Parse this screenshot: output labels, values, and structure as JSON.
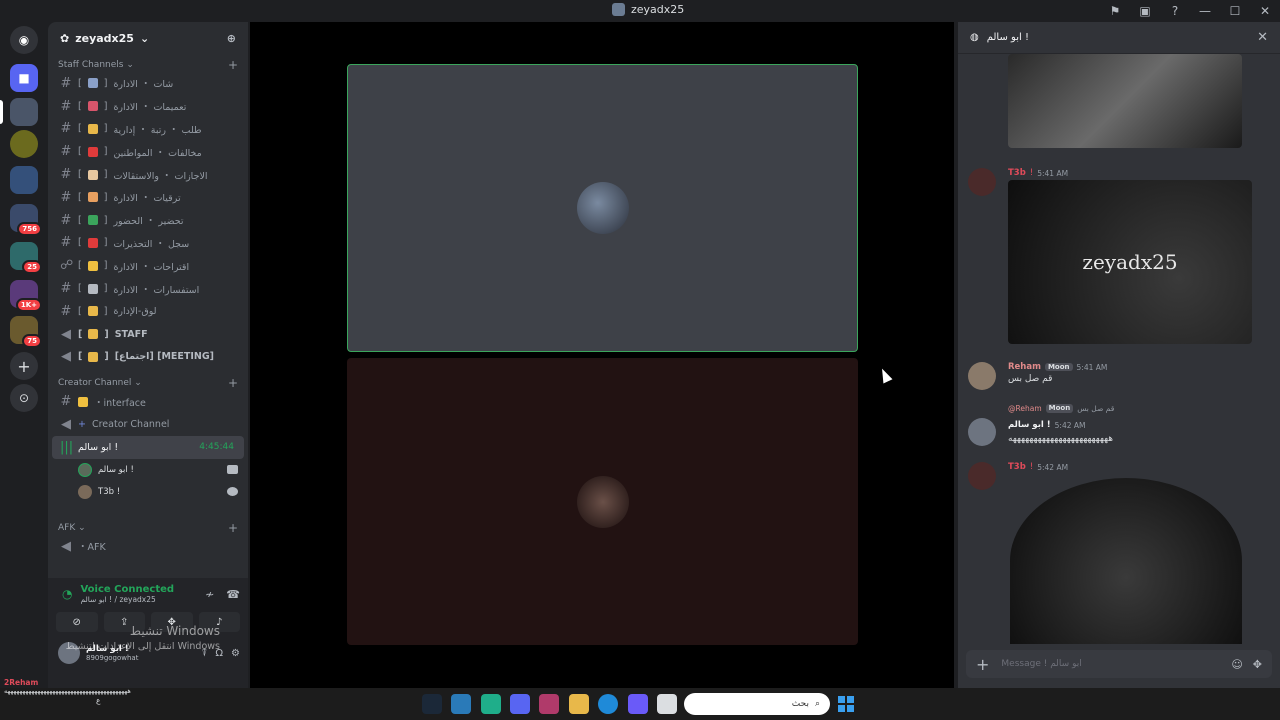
{
  "window": {
    "title": "zeyadx25"
  },
  "guild_badges": {
    "b1": "756",
    "b2": "25",
    "b3": "1K+",
    "b4": "75"
  },
  "server": {
    "name": "zeyadx25"
  },
  "categories": {
    "staff": "Staff Channels",
    "creator": "Creator Channel",
    "afk": "AFK"
  },
  "staff_channels": [
    {
      "label": "شات ・ الادارة",
      "color": "#8aa0c8"
    },
    {
      "label": "تعميمات ・ الادارة",
      "color": "#d8556b"
    },
    {
      "label": "طلب ・ رتبة ・ إدارية",
      "color": "#e8b84a"
    },
    {
      "label": "مخالفات ・ المواطنين",
      "color": "#e03b3b"
    },
    {
      "label": "الاجازات ・ والاستقالات",
      "color": "#e8c8a0"
    },
    {
      "label": "ترقيات ・ الادارة",
      "color": "#e8a060"
    },
    {
      "label": "تحضير ・ الحضور",
      "color": "#3ba55c"
    },
    {
      "label": "سجل ・ التحذيرات",
      "color": "#e03b3b"
    },
    {
      "label": "اقتراحات ・ الادارة",
      "color": "#f0c040"
    },
    {
      "label": "استفسارات ・ الادارة",
      "color": "#b5bac1"
    },
    {
      "label": "لوق-الإدارة",
      "color": "#e8b84a"
    }
  ],
  "staff_voice": [
    {
      "label": "STAFF"
    },
    {
      "label": "[اجتماع] [MEETING]"
    }
  ],
  "creator_channels": [
    {
      "label": "・interface"
    },
    {
      "label": "Creator Channel"
    }
  ],
  "active_voice": {
    "label": "ابو سالم !",
    "time": "4:45:44"
  },
  "voice_users": [
    {
      "name": "ابو سالم !"
    },
    {
      "name": "T3b !"
    }
  ],
  "afk_channel": {
    "label": "・AFK"
  },
  "voice_panel": {
    "status": "Voice Connected",
    "location": "ابو سالم ! / zeyadx25"
  },
  "user": {
    "name": "ابو سالم !",
    "status": "8909gogowhat"
  },
  "watermark": {
    "line1": "تنشيط Windows",
    "line2": "انتقل إلى الإعدادات لتنشيط Windows"
  },
  "chat": {
    "title": "ابو سالم !",
    "messages": [
      {
        "name": "T3b",
        "badge": "!",
        "time": "5:41 AM",
        "image_text": "zeyadx25",
        "name_color": "#e04b5a"
      },
      {
        "name": "Reham",
        "tag": "Moon",
        "time": "5:41 AM",
        "text": "قم صل بس",
        "name_color": "#e08a8a"
      },
      {
        "reply_name": "@Reham",
        "reply_tag": "Moon",
        "reply_text": "قم صل بس",
        "name": "ابو سالم !",
        "time": "5:42 AM",
        "text": "ههههههههههههههههههههههههه"
      },
      {
        "name": "T3b",
        "badge": "!",
        "time": "5:42 AM",
        "name_color": "#e04b5a"
      }
    ],
    "placeholder": "Message ! ابو سالم"
  },
  "taskbar": {
    "user_tag": "2Reham",
    "line1": "هههههههههههههههههههههههههههههههههههههههههه",
    "line2": "ع",
    "search_placeholder": "بحث"
  }
}
